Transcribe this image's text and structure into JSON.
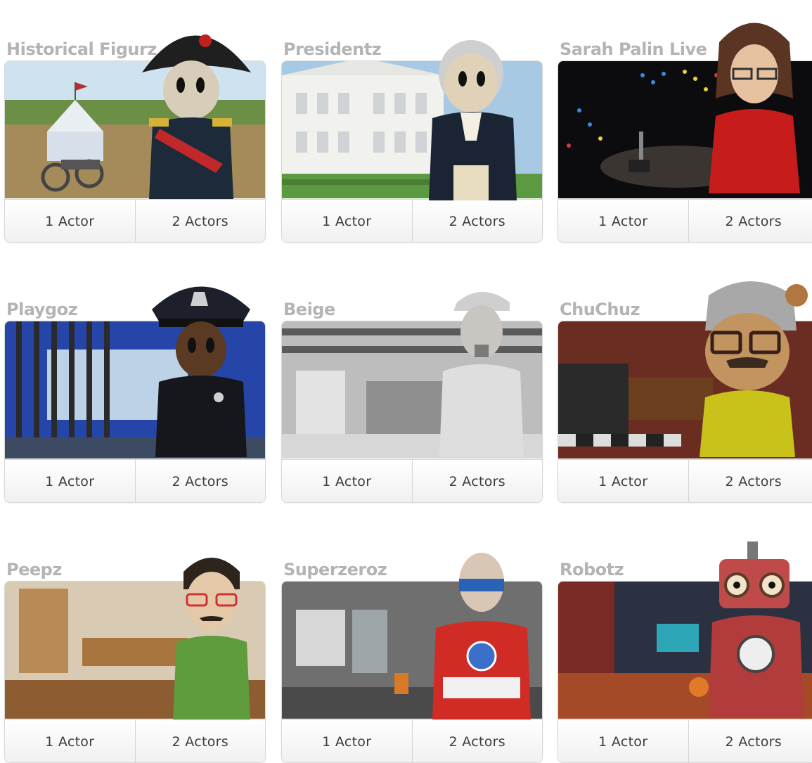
{
  "buttons": {
    "one": "1 Actor",
    "two": "2 Actors"
  },
  "cards": [
    {
      "title": "Historical Figurz",
      "scene": "campsite"
    },
    {
      "title": "Presidentz",
      "scene": "white-house"
    },
    {
      "title": "Sarah Palin Live",
      "scene": "news-studio"
    },
    {
      "title": "Playgoz",
      "scene": "police-station"
    },
    {
      "title": "Beige",
      "scene": "garage"
    },
    {
      "title": "ChuChuz",
      "scene": "lounge"
    },
    {
      "title": "Peepz",
      "scene": "office"
    },
    {
      "title": "Superzeroz",
      "scene": "subway"
    },
    {
      "title": "Robotz",
      "scene": "bar"
    }
  ]
}
